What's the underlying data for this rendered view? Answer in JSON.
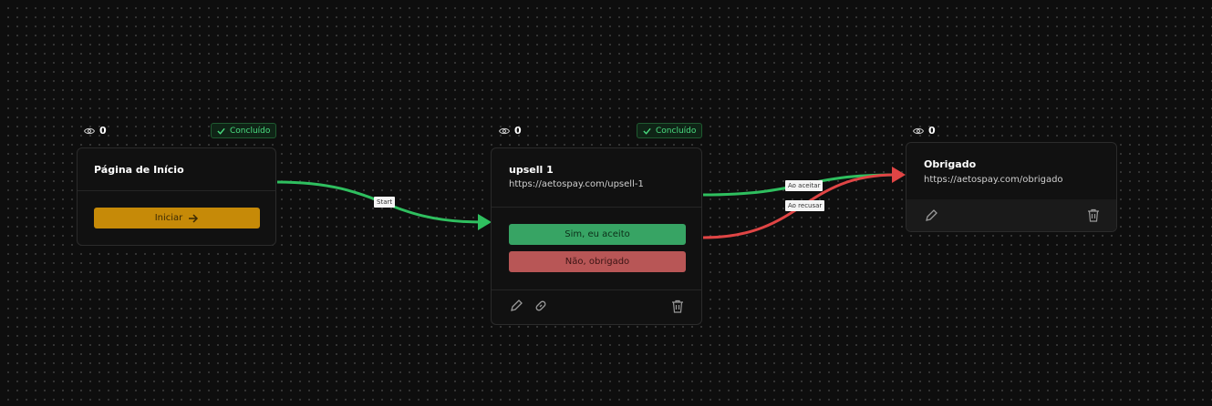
{
  "colors": {
    "accept": "#2fbf5f",
    "reject": "#e04545",
    "start_button": "#c68a08",
    "yes_button": "#37a464",
    "no_button": "#b85656",
    "badge_text": "#4ade80"
  },
  "edges": {
    "start_label": "Start",
    "accept_label": "Ao aceitar",
    "reject_label": "Ao recusar"
  },
  "nodes": {
    "home": {
      "views": "0",
      "badge": "Concluído",
      "title": "Página de Início",
      "button": "Iniciar"
    },
    "upsell": {
      "views": "0",
      "badge": "Concluído",
      "title": "upsell 1",
      "url": "https://aetospay.com/upsell-1",
      "accept_button": "Sim, eu aceito",
      "reject_button": "Não, obrigado"
    },
    "thanks": {
      "views": "0",
      "title": "Obrigado",
      "url": "https://aetospay.com/obrigado"
    }
  },
  "icons": {
    "views": "eye-icon",
    "badge": "check-icon",
    "start": "arrow-right-icon",
    "edit": "pencil-icon",
    "link": "link-icon",
    "delete": "trash-icon"
  }
}
